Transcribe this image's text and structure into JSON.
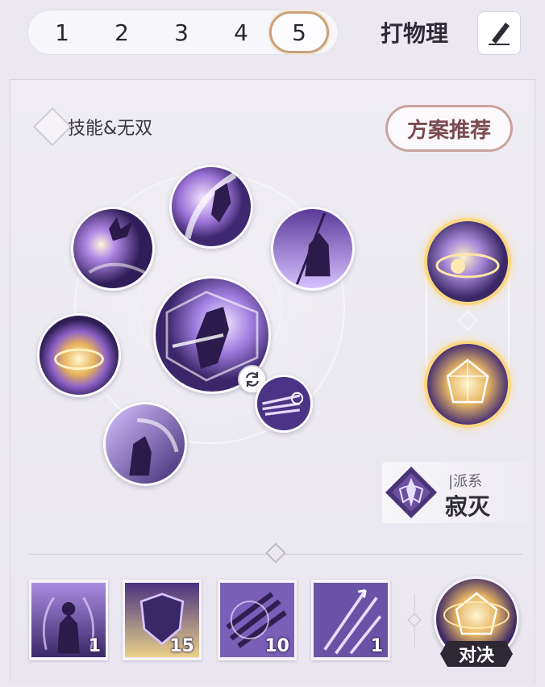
{
  "tabs": [
    "1",
    "2",
    "3",
    "4",
    "5"
  ],
  "active_tab_index": 4,
  "build_name": "打物理",
  "section_title": "技能&无双",
  "recommend_label": "方案推荐",
  "faction": {
    "type_label": "|派系",
    "name": "寂灭"
  },
  "items": [
    {
      "name": "flame-aura-body",
      "count": "1"
    },
    {
      "name": "purple-shield",
      "count": "15"
    },
    {
      "name": "daggers-burst",
      "count": "10"
    },
    {
      "name": "rising-arrows",
      "count": "1"
    }
  ],
  "duel_label": "对决",
  "colors": {
    "accent_gold": "#c9a27a",
    "recommend_border": "#c9a2a0",
    "skill_purple": "#6a4aa8"
  }
}
